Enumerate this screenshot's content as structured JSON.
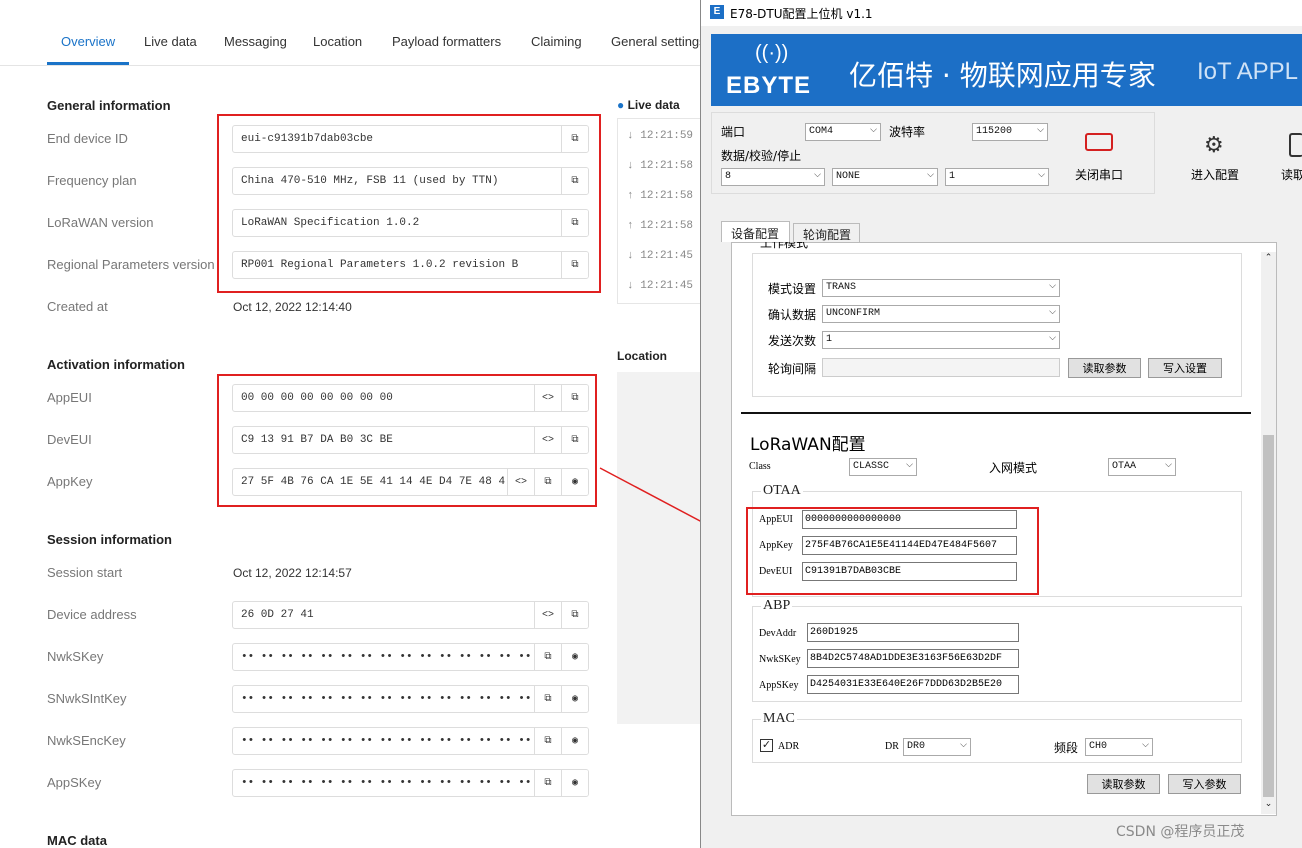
{
  "ttn": {
    "tabs": [
      "Overview",
      "Live data",
      "Messaging",
      "Location",
      "Payload formatters",
      "Claiming",
      "General settings"
    ],
    "general": {
      "title": "General information",
      "rows": [
        {
          "label": "End device ID",
          "value": "eui-c91391b7dab03cbe"
        },
        {
          "label": "Frequency plan",
          "value": "China 470-510 MHz, FSB 11 (used by TTN)"
        },
        {
          "label": "LoRaWAN version",
          "value": "LoRaWAN Specification 1.0.2"
        },
        {
          "label": "Regional Parameters version",
          "value": "RP001 Regional Parameters 1.0.2 revision B"
        }
      ],
      "created_label": "Created at",
      "created_value": "Oct 12, 2022 12:14:40"
    },
    "activation": {
      "title": "Activation information",
      "rows": [
        {
          "label": "AppEUI",
          "value": "00 00 00 00 00 00 00 00"
        },
        {
          "label": "DevEUI",
          "value": "C9 13 91 B7 DA B0 3C BE"
        },
        {
          "label": "AppKey",
          "value": "27 5F 4B 76 CA 1E 5E 41 14 4E D4 7E 48 4..."
        }
      ]
    },
    "session": {
      "title": "Session information",
      "start_label": "Session start",
      "start_value": "Oct 12, 2022 12:14:57",
      "rows": [
        {
          "label": "Device address",
          "value": "26 0D 27 41"
        },
        {
          "label": "NwkSKey",
          "value": "•• •• •• •• •• •• •• •• •• •• •• •• •• •• •• ••"
        },
        {
          "label": "SNwkSIntKey",
          "value": "•• •• •• •• •• •• •• •• •• •• •• •• •• •• •• ••"
        },
        {
          "label": "NwkSEncKey",
          "value": "•• •• •• •• •• •• •• •• •• •• •• •• •• •• •• ••"
        },
        {
          "label": "AppSKey",
          "value": "•• •• •• •• •• •• •• •• •• •• •• •• •• •• •• ••"
        }
      ]
    },
    "mac_title": "MAC data",
    "live": {
      "title": "Live data",
      "rows": [
        {
          "dir": "down",
          "time": "12:21:59"
        },
        {
          "dir": "down",
          "time": "12:21:58"
        },
        {
          "dir": "up",
          "time": "12:21:58"
        },
        {
          "dir": "up",
          "time": "12:21:58"
        },
        {
          "dir": "down",
          "time": "12:21:45"
        },
        {
          "dir": "down",
          "time": "12:21:45"
        }
      ]
    },
    "location_title": "Location"
  },
  "win": {
    "title": "E78-DTU配置上位机 v1.1",
    "brand": "EBYTE",
    "slogan": "亿佰特 · 物联网应用专家",
    "slogan2": "IoT APPL",
    "port_label": "端口",
    "port": "COM4",
    "baud_label": "波特率",
    "baud": "115200",
    "dps_label": "数据/校验/停止",
    "data_bits": "8",
    "parity": "NONE",
    "stop_bits": "1",
    "close_port": "关闭串口",
    "enter_config": "进入配置",
    "read": "读取",
    "tabs": [
      "设备配置",
      "轮询配置"
    ],
    "work_mode": "工作模式",
    "mode_label": "模式设置",
    "mode": "TRANS",
    "confirm_label": "确认数据",
    "confirm": "UNCONFIRM",
    "send_label": "发送次数",
    "send": "1",
    "poll_label": "轮询间隔",
    "poll": "",
    "read_params": "读取参数",
    "write_settings": "写入设置",
    "lorawan_title": "LoRaWAN配置",
    "class_label": "Class",
    "class": "CLASSC",
    "join_label": "入网模式",
    "join": "OTAA",
    "otaa_title": "OTAA",
    "appeui_label": "AppEUI",
    "appeui": "0000000000000000",
    "appkey_label": "AppKey",
    "appkey": "275F4B76CA1E5E41144ED47E484F5607",
    "deveui_label": "DevEUI",
    "deveui": "C91391B7DAB03CBE",
    "abp_title": "ABP",
    "devaddr_label": "DevAddr",
    "devaddr": "260D1925",
    "nwkskey_label": "NwkSKey",
    "nwkskey": "8B4D2C5748AD1DDE3E3163F56E63D2DF",
    "appskey_label": "AppSKey",
    "appskey": "D4254031E33E640E26F7DDD63D2B5E20",
    "mac_title": "MAC",
    "adr_label": "ADR",
    "dr_label": "DR",
    "dr": "DR0",
    "freq_label": "频段",
    "freq": "CH0",
    "read_params2": "读取参数",
    "write_params": "写入参数"
  },
  "watermark": "CSDN @程序员正茂"
}
